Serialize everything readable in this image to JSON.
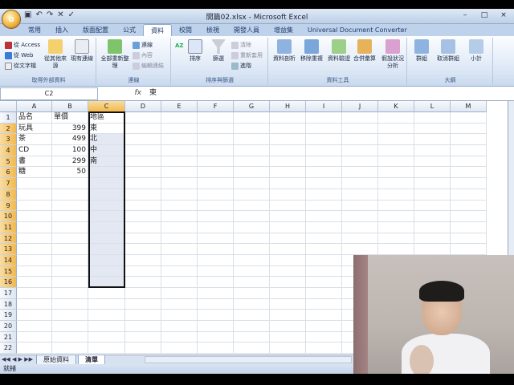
{
  "window": {
    "title": "開篇02.xlsx - Microsoft Excel",
    "office_button": "O",
    "qat": [
      "save-icon",
      "undo-icon",
      "redo-icon",
      "close-icon",
      "check-icon"
    ],
    "controls": [
      "–",
      "□",
      "×"
    ]
  },
  "tabs": [
    "常用",
    "插入",
    "版面配置",
    "公式",
    "資料",
    "校閱",
    "檢視",
    "開發人員",
    "增益集",
    "Universal Document Converter"
  ],
  "active_tab": "資料",
  "ribbon": {
    "groups": [
      {
        "label": "取得外部資料",
        "small": [
          "從 Access",
          "從 Web",
          "從文字檔"
        ],
        "big": [
          "從其他來源",
          "現有連線"
        ]
      },
      {
        "label": "連線",
        "big": [
          "全部重新整理"
        ],
        "small": [
          "連線",
          "內容",
          "編輯連結"
        ]
      },
      {
        "label": "排序與篩選",
        "big": [
          "排序",
          "篩選"
        ],
        "small": [
          "清除",
          "重新套用",
          "進階"
        ],
        "icon_text": "AZ"
      },
      {
        "label": "資料工具",
        "big": [
          "資料剖析",
          "移除重複",
          "資料驗證",
          "合併彙算",
          "假設狀況分析"
        ]
      },
      {
        "label": "大綱",
        "big": [
          "群組",
          "取消群組",
          "小計"
        ]
      }
    ]
  },
  "formula_bar": {
    "name_box": "C2",
    "fx": "fx",
    "value": "東"
  },
  "sheet": {
    "columns": [
      "A",
      "B",
      "C",
      "D",
      "E",
      "F",
      "G",
      "H",
      "I",
      "J",
      "K",
      "L",
      "M"
    ],
    "row_numbers": [
      "1",
      "2",
      "3",
      "4",
      "5",
      "6",
      "7",
      "8",
      "9",
      "10",
      "11",
      "12",
      "13",
      "14",
      "15",
      "16",
      "17",
      "18",
      "19",
      "20",
      "21",
      "22"
    ],
    "cells": [
      [
        "品名",
        "單價",
        "地區"
      ],
      [
        "玩具",
        "399",
        "東"
      ],
      [
        "茶",
        "499",
        "北"
      ],
      [
        "CD",
        "100",
        "中"
      ],
      [
        "書",
        "299",
        "南"
      ],
      [
        "糖",
        "50",
        ""
      ]
    ],
    "selected_column": "C"
  },
  "sheet_tabs": [
    "原始資料",
    "清單"
  ],
  "active_sheet": "清單",
  "status": "就緒"
}
